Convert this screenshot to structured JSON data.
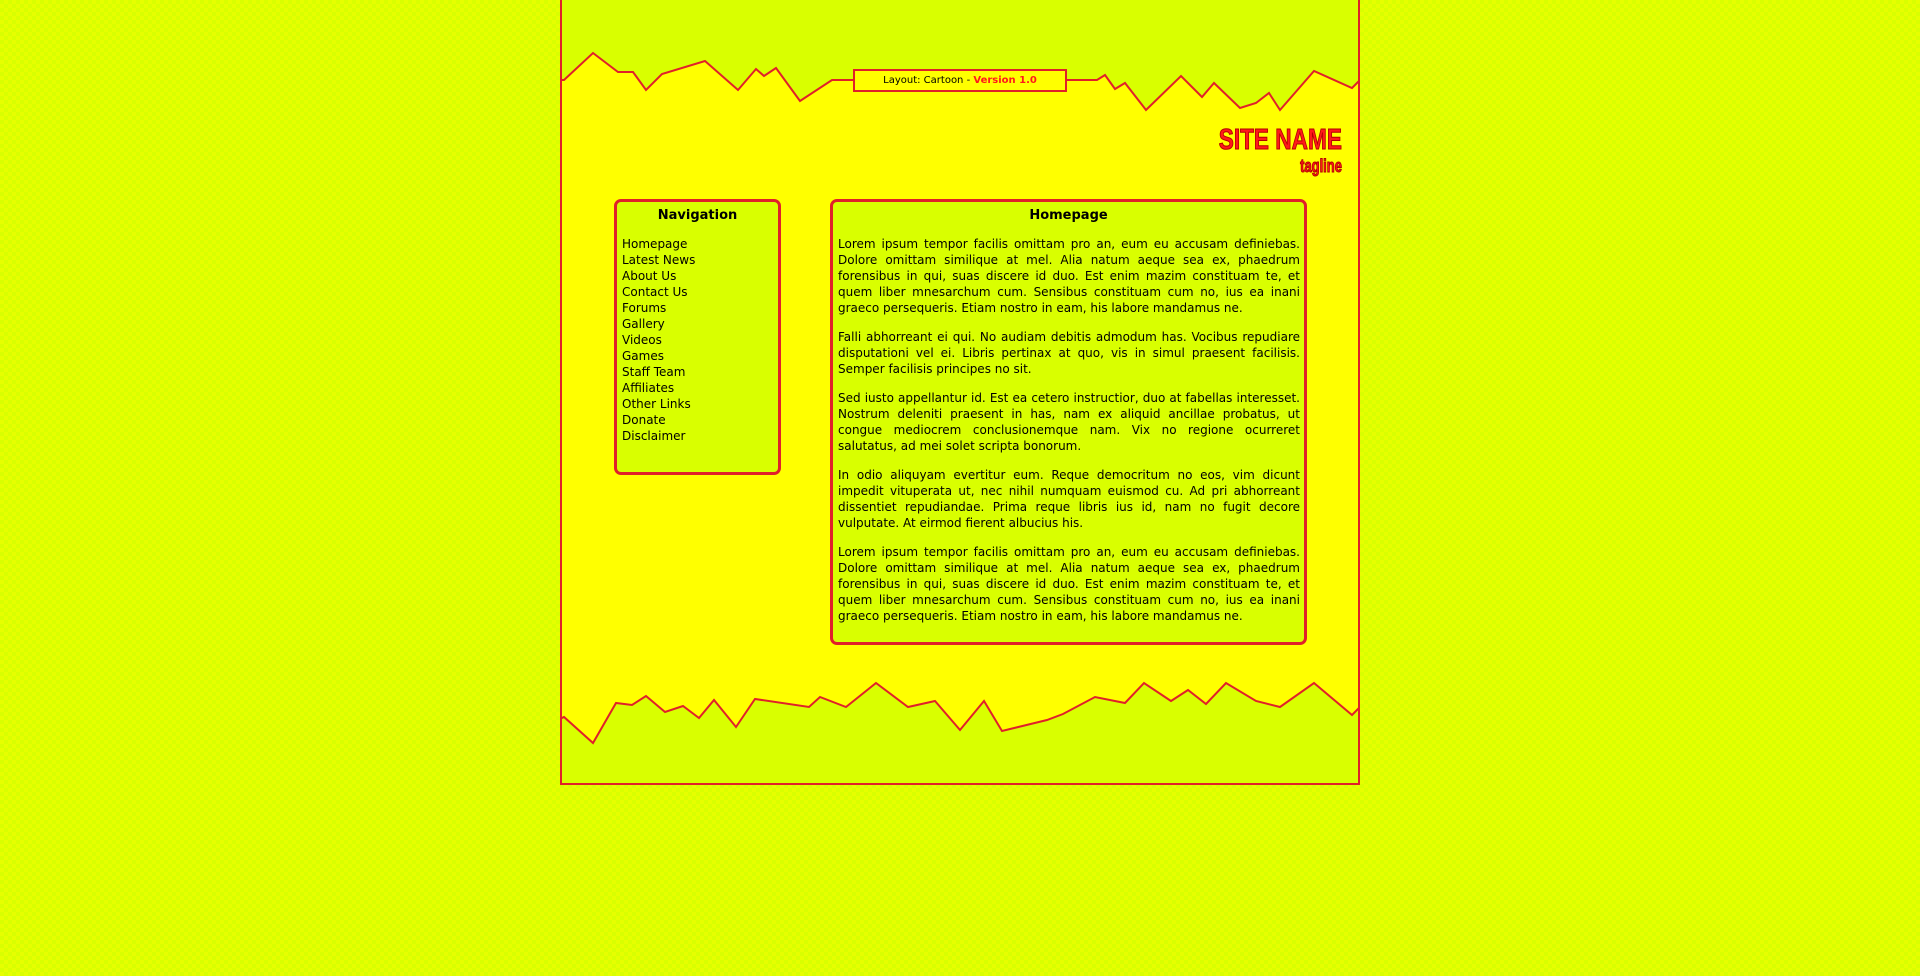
{
  "header": {
    "layout_label": "Layout: Cartoon - ",
    "version_label": "Version 1.0",
    "site_name": "SITE NAME",
    "tagline": "tagline"
  },
  "navigation": {
    "title": "Navigation",
    "items": [
      "Homepage",
      "Latest News",
      "About Us",
      "Contact Us",
      "Forums",
      "Gallery",
      "Videos",
      "Games",
      "Staff Team",
      "Affiliates",
      "Other Links",
      "Donate",
      "Disclaimer"
    ]
  },
  "content": {
    "title": "Homepage",
    "paragraphs": [
      "Lorem ipsum tempor facilis omittam pro an, eum eu accusam definiebas. Dolore omittam similique at mel. Alia natum aeque sea ex, phaedrum forensibus in qui, suas discere id duo. Est enim mazim constituam te, et quem liber mnesarchum cum. Sensibus constituam cum no, ius ea inani graeco persequeris. Etiam nostro in eam, his labore mandamus ne.",
      "Falli abhorreant ei qui. No audiam debitis admodum has. Vocibus repudiare disputationi vel ei. Libris pertinax at quo, vis in simul praesent facilisis. Semper facilisis principes no sit.",
      "Sed iusto appellantur id. Est ea cetero instructior, duo at fabellas interesset. Nostrum deleniti praesent in has, nam ex aliquid ancillae probatus, ut congue mediocrem conclusionemque nam. Vix no regione ocurreret salutatus, ad mei solet scripta bonorum.",
      "In odio aliquyam evertitur eum. Reque democritum no eos, vim dicunt impedit vituperata ut, nec nihil numquam euismod cu. Ad pri abhorreant dissentiet repudiandae. Prima reque libris ius id, nam no fugit decore vulputate. At eirmod fierent albucius his.",
      "Lorem ipsum tempor facilis omittam pro an, eum eu accusam definiebas. Dolore omittam similique at mel. Alia natum aeque sea ex, phaedrum forensibus in qui, suas discere id duo. Est enim mazim constituam te, et quem liber mnesarchum cum. Sensibus constituam cum no, ius ea inani graeco persequeris. Etiam nostro in eam, his labore mandamus ne."
    ]
  },
  "colors": {
    "page_bg": "#d9ff00",
    "main_bg": "#ffff00",
    "border": "#e0202a",
    "accent": "#ff1a1a"
  }
}
